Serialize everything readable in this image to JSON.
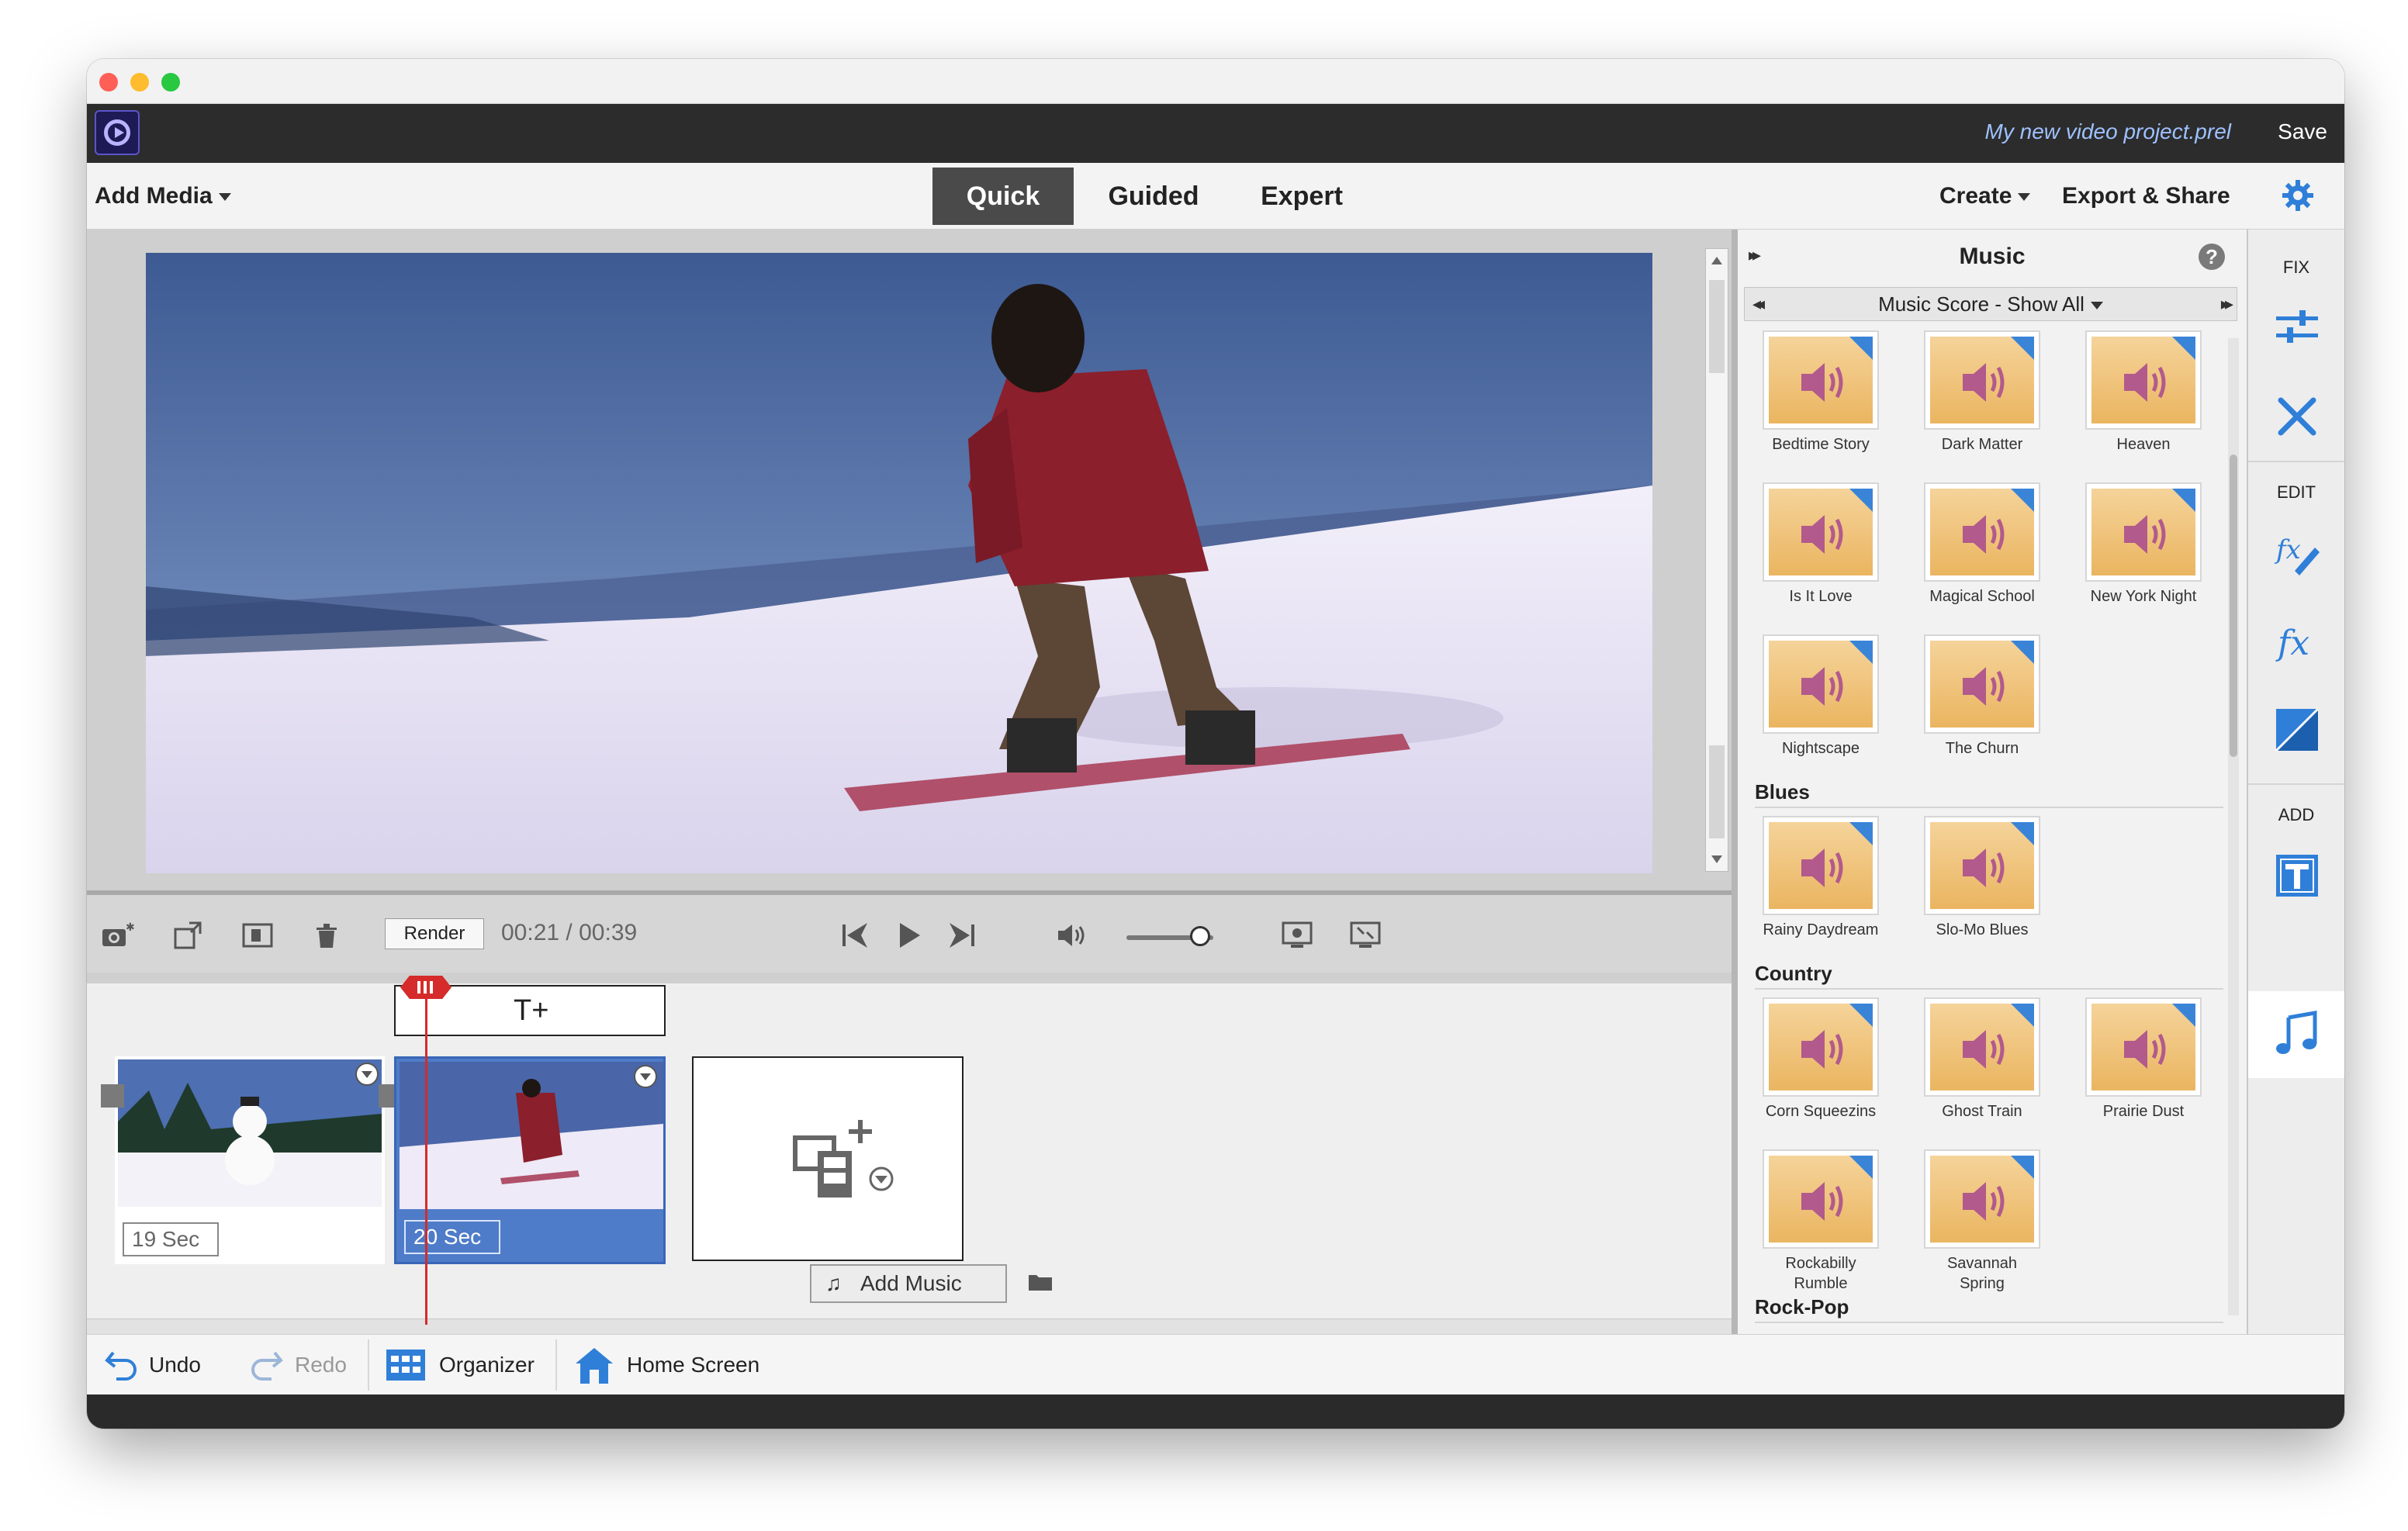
{
  "window": {
    "project_title": "My new video project.prel",
    "save_label": "Save"
  },
  "menubar": {
    "add_media_label": "Add Media",
    "modes": [
      "Quick",
      "Guided",
      "Expert"
    ],
    "active_mode": "Quick",
    "create_label": "Create",
    "export_label": "Export & Share"
  },
  "controls": {
    "render_label": "Render",
    "current_time": "00:21",
    "time_separator": "/",
    "total_time": "00:39",
    "volume": 0.85
  },
  "timeline": {
    "clips": [
      {
        "duration": "19 Sec",
        "selected": false
      },
      {
        "duration": "20 Sec",
        "selected": true
      }
    ],
    "title_track_icon": "add-text-icon",
    "add_music_label": "Add Music"
  },
  "bottombar": {
    "undo_label": "Undo",
    "redo_label": "Redo",
    "organizer_label": "Organizer",
    "home_label": "Home Screen"
  },
  "panel": {
    "title": "Music",
    "filter_label": "Music Score - Show All",
    "tiles_top": [
      "Bedtime Story",
      "Dark Matter",
      "Heaven",
      "Is It Love",
      "Magical School",
      "New York Night",
      "Nightscape",
      "The Churn"
    ],
    "categories": [
      {
        "name": "Blues",
        "items": [
          "Rainy Daydream",
          "Slo-Mo Blues"
        ]
      },
      {
        "name": "Country",
        "items": [
          "Corn Squeezins",
          "Ghost Train",
          "Prairie Dust",
          "Rockabilly Rumble",
          "Savannah Spring"
        ]
      },
      {
        "name": "Rock-Pop",
        "items": []
      }
    ]
  },
  "sidebar": {
    "fix_label": "FIX",
    "edit_label": "EDIT",
    "add_label": "ADD",
    "active_item": "music",
    "icons": [
      "adjustments-icon",
      "tools-icon",
      "applied-effects-icon",
      "effects-icon",
      "transitions-icon",
      "titles-icon",
      "music-icon"
    ]
  },
  "colors": {
    "accent": "#3a66b8",
    "playhead": "#d52b2b",
    "app_bar": "#2c2c2c",
    "project_title": "#9ec1ff"
  }
}
